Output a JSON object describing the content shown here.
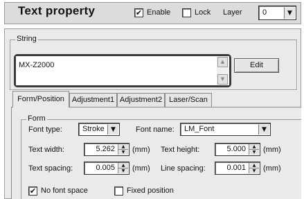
{
  "header": {
    "title": "Text property",
    "enable": {
      "label": "Enable",
      "checked": true
    },
    "lock": {
      "label": "Lock",
      "checked": false
    },
    "layer": {
      "label": "Layer",
      "value": "0"
    }
  },
  "string_group": {
    "legend": "String",
    "text": "MX-Z2000",
    "edit_label": "Edit"
  },
  "tabs": [
    {
      "label": "Form/Position",
      "active": true
    },
    {
      "label": "Adjustment1",
      "active": false
    },
    {
      "label": "Adjustment2",
      "active": false
    },
    {
      "label": "Laser/Scan",
      "active": false
    }
  ],
  "form": {
    "legend": "Form",
    "font_type_label": "Font type:",
    "font_type_value": "Stroke",
    "font_name_label": "Font name:",
    "font_name_value": "LM_Font",
    "text_width_label": "Text width:",
    "text_width_value": "5.262",
    "text_height_label": "Text height:",
    "text_height_value": "5.000",
    "text_spacing_label": "Text spacing:",
    "text_spacing_value": "0.005",
    "line_spacing_label": "Line spacing:",
    "line_spacing_value": "0.001",
    "unit": "(mm)",
    "no_font_space": {
      "label": "No font space",
      "checked": true
    },
    "fixed_position": {
      "label": "Fixed position",
      "checked": false
    }
  },
  "icons": {
    "check": "✔",
    "dropdown": "▼",
    "up": "▲",
    "down": "▼"
  }
}
